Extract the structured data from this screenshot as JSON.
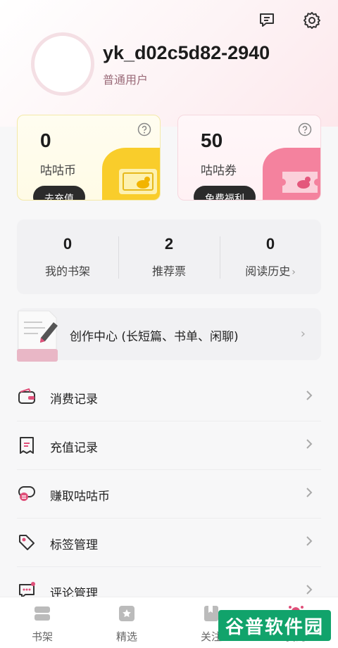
{
  "header": {
    "message_icon": "message-icon",
    "settings_icon": "gear-icon"
  },
  "profile": {
    "username": "yk_d02c5d82-2940",
    "user_type": "普通用户"
  },
  "wallet": {
    "coins": {
      "value": "0",
      "label": "咕咕币",
      "action": "去充值"
    },
    "tickets": {
      "value": "50",
      "label": "咕咕券",
      "action": "免费福利"
    }
  },
  "stats": [
    {
      "value": "0",
      "label": "我的书架"
    },
    {
      "value": "2",
      "label": "推荐票"
    },
    {
      "value": "0",
      "label": "阅读历史"
    }
  ],
  "stats_chevron": "›",
  "creation": {
    "label": "创作中心 (长短篇、书单、闲聊)",
    "arrow": "›"
  },
  "menu": [
    {
      "label": "消费记录",
      "icon": "wallet-icon"
    },
    {
      "label": "充值记录",
      "icon": "receipt-icon"
    },
    {
      "label": "赚取咕咕币",
      "icon": "coin-icon"
    },
    {
      "label": "标签管理",
      "icon": "tag-icon"
    },
    {
      "label": "评论管理",
      "icon": "comment-icon"
    }
  ],
  "tabs": [
    {
      "label": "书架",
      "icon": "bookshelf-icon"
    },
    {
      "label": "精选",
      "icon": "featured-icon"
    },
    {
      "label": "关注",
      "icon": "follow-icon"
    },
    {
      "label": "我的",
      "icon": "profile-icon"
    }
  ],
  "watermark": "谷普软件园",
  "colors": {
    "accent": "#e0507a",
    "coin_yellow": "#f9cd2b",
    "ticket_pink": "#f4829e"
  }
}
